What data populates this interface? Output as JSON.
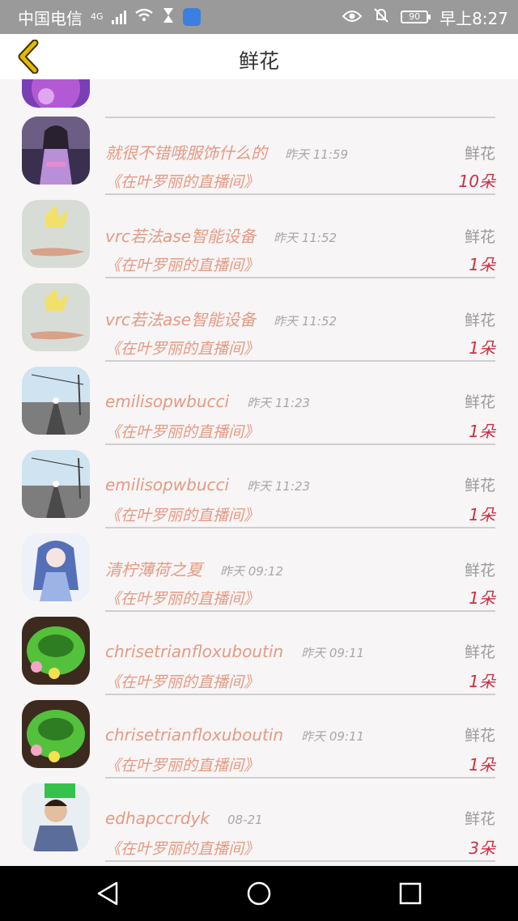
{
  "status_bar": {
    "carrier": "中国电信",
    "network": "4G",
    "battery": "90",
    "time": "早上8:27"
  },
  "header": {
    "title": "鲜花"
  },
  "rows": [
    {
      "name": "就很不错哦服饰什么的",
      "time": "昨天 11:59",
      "gift": "鲜花",
      "room": "《在叶罗丽的直播间》",
      "count": "10朵",
      "avatar": "avatar-girl-purple"
    },
    {
      "name": "vrc若法ase智能设备",
      "time": "昨天 11:52",
      "gift": "鲜花",
      "room": "《在叶罗丽的直播间》",
      "count": "1朵",
      "avatar": "avatar-paper-crane"
    },
    {
      "name": "vrc若法ase智能设备",
      "time": "昨天 11:52",
      "gift": "鲜花",
      "room": "《在叶罗丽的直播间》",
      "count": "1朵",
      "avatar": "avatar-paper-crane"
    },
    {
      "name": "emilisopwbucci",
      "time": "昨天 11:23",
      "gift": "鲜花",
      "room": "《在叶罗丽的直播间》",
      "count": "1朵",
      "avatar": "avatar-road"
    },
    {
      "name": "emilisopwbucci",
      "time": "昨天 11:23",
      "gift": "鲜花",
      "room": "《在叶罗丽的直播间》",
      "count": "1朵",
      "avatar": "avatar-road"
    },
    {
      "name": "清柠薄荷之夏",
      "time": "昨天 09:12",
      "gift": "鲜花",
      "room": "《在叶罗丽的直播间》",
      "count": "1朵",
      "avatar": "avatar-anime-girl"
    },
    {
      "name": "chrisetrianfloxuboutin",
      "time": "昨天 09:11",
      "gift": "鲜花",
      "room": "《在叶罗丽的直播间》",
      "count": "1朵",
      "avatar": "avatar-green-ring"
    },
    {
      "name": "chrisetrianfloxuboutin",
      "time": "昨天 09:11",
      "gift": "鲜花",
      "room": "《在叶罗丽的直播间》",
      "count": "1朵",
      "avatar": "avatar-green-ring"
    },
    {
      "name": "edhapccrdyk",
      "time": "08-21",
      "gift": "鲜花",
      "room": "《在叶罗丽的直播间》",
      "count": "3朵",
      "avatar": "avatar-man"
    }
  ],
  "colors": {
    "name": "#e49a84",
    "count": "#cc2e46",
    "muted": "#9b9b9b",
    "back_arrow": "#e8b800"
  }
}
